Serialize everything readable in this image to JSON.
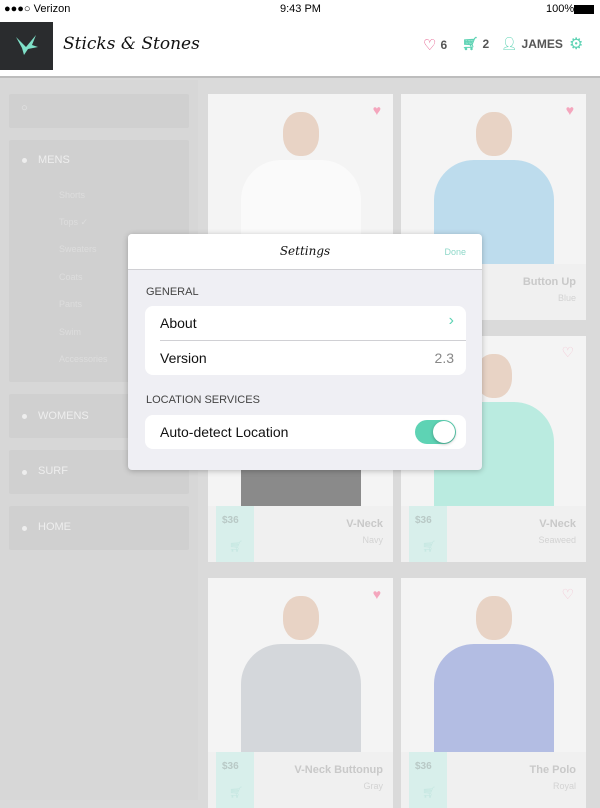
{
  "status_bar": {
    "carrier": "●●●○ Verizon",
    "time": "9:43 PM",
    "battery": "100%"
  },
  "header": {
    "brand": "Sticks & Stones",
    "favorites_count": "6",
    "cart_count": "2",
    "user": "JAMES",
    "accent": "#5ed3b4",
    "heart_color": "#e0457b"
  },
  "sidebar": {
    "search_placeholder": "",
    "categories": [
      {
        "label": "MENS"
      },
      {
        "label": "WOMENS"
      },
      {
        "label": "SURF"
      },
      {
        "label": "HOME"
      }
    ],
    "mens_sub": [
      {
        "label": "Shorts"
      },
      {
        "label": "Tops",
        "checked": true
      },
      {
        "label": "Sweaters"
      },
      {
        "label": "Coats"
      },
      {
        "label": "Pants"
      },
      {
        "label": "Swim"
      },
      {
        "label": "Accessories"
      }
    ]
  },
  "products": [
    {
      "name": "",
      "color": "",
      "price": "",
      "shirt": "#ffffff",
      "favorited": true
    },
    {
      "name": "Button Up",
      "color": "Blue",
      "price": "",
      "shirt": "#8fc8e8",
      "favorited": true
    },
    {
      "name": "V-Neck",
      "color": "Navy",
      "price": "$36",
      "shirt": "#333333",
      "favorited": false
    },
    {
      "name": "V-Neck",
      "color": "Seaweed",
      "price": "$36",
      "shirt": "#8be3cf",
      "favorited": false
    },
    {
      "name": "V-Neck Buttonup",
      "color": "Gray",
      "price": "$36",
      "shirt": "#b9bfc6",
      "favorited": true
    },
    {
      "name": "The Polo",
      "color": "Royal",
      "price": "$36",
      "shirt": "#7d8fd6",
      "favorited": false
    }
  ],
  "settings": {
    "title": "Settings",
    "done": "Done",
    "general_header": "GENERAL",
    "about": "About",
    "version_label": "Version",
    "version_value": "2.3",
    "location_header": "LOCATION SERVICES",
    "auto_detect": "Auto-detect Location",
    "auto_detect_on": true
  }
}
